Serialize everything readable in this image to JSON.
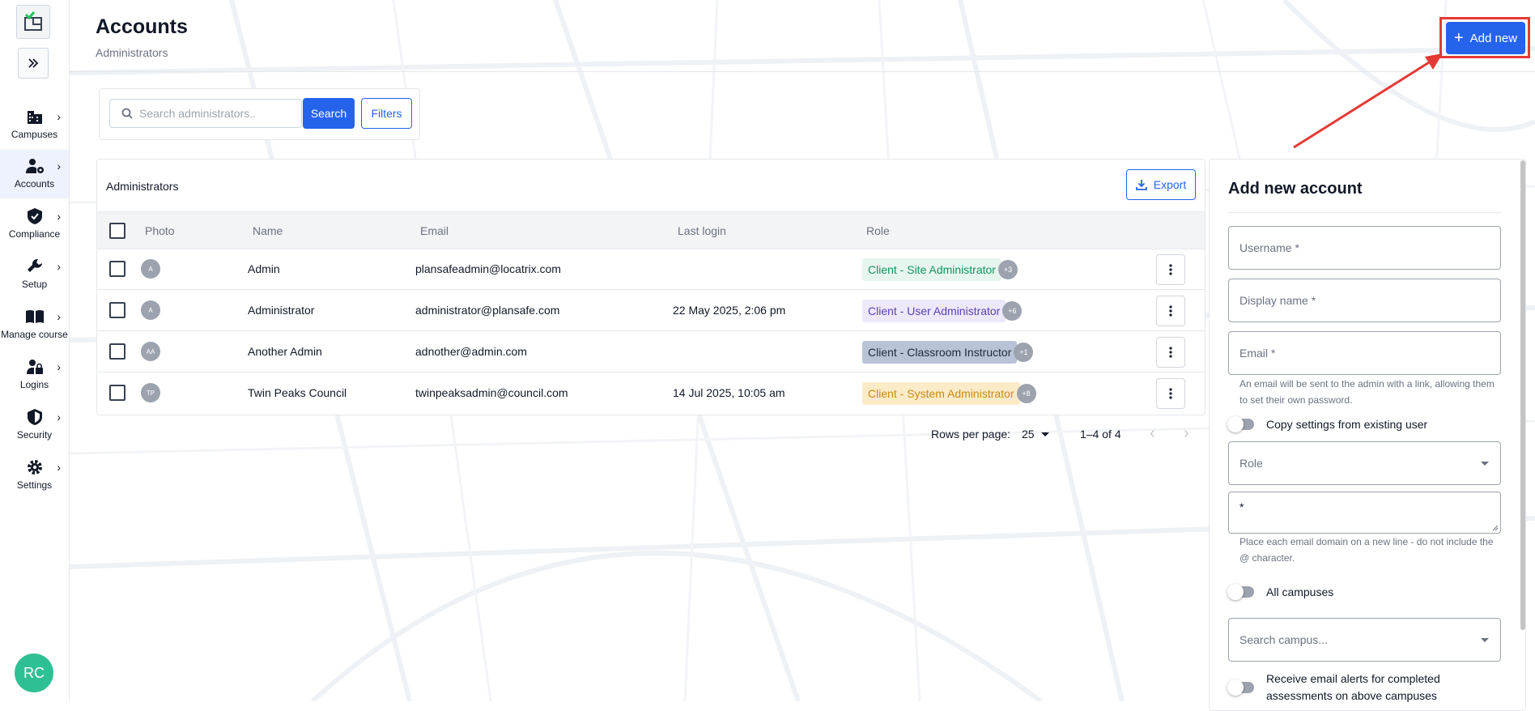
{
  "sidebar": {
    "items": [
      {
        "label": "Campuses",
        "icon": "building-icon"
      },
      {
        "label": "Accounts",
        "icon": "users-cog-icon",
        "active": true
      },
      {
        "label": "Compliance",
        "icon": "shield-check-icon"
      },
      {
        "label": "Setup",
        "icon": "wrench-icon"
      },
      {
        "label": "Manage course",
        "icon": "book-icon"
      },
      {
        "label": "Logins",
        "icon": "user-lock-icon"
      },
      {
        "label": "Security",
        "icon": "shield-half-icon"
      },
      {
        "label": "Settings",
        "icon": "gear-icon"
      }
    ],
    "user_initials": "RC"
  },
  "header": {
    "title": "Accounts",
    "subtitle": "Administrators",
    "add_new_label": "Add new"
  },
  "search": {
    "placeholder": "Search administrators..",
    "search_label": "Search",
    "filters_label": "Filters"
  },
  "table": {
    "title": "Administrators",
    "export_label": "Export",
    "columns": {
      "photo": "Photo",
      "name": "Name",
      "email": "Email",
      "last_login": "Last login",
      "role": "Role"
    },
    "rows": [
      {
        "initials": "A",
        "name": "Admin",
        "email": "plansafeadmin@locatrix.com",
        "last_login": "",
        "role": "Client - Site Administrator",
        "more": "+3"
      },
      {
        "initials": "A",
        "name": "Administrator",
        "email": "administrator@plansafe.com",
        "last_login": "22 May 2025, 2:06 pm",
        "role": "Client - User Administrator",
        "more": "+6"
      },
      {
        "initials": "AA",
        "name": "Another Admin",
        "email": "adnother@admin.com",
        "last_login": "",
        "role": "Client - Classroom Instructor",
        "more": "+1"
      },
      {
        "initials": "TP",
        "name": "Twin Peaks Council",
        "email": "twinpeaksadmin@council.com",
        "last_login": "14 Jul 2025, 10:05 am",
        "role": "Client - System Administrator",
        "more": "+8"
      }
    ]
  },
  "pagination": {
    "rows_per_page_label": "Rows per page:",
    "rows_per_page": "25",
    "range": "1–4 of 4"
  },
  "form": {
    "title": "Add new account",
    "username_placeholder": "Username *",
    "display_name_placeholder": "Display name *",
    "email_placeholder": "Email *",
    "email_help": "An email will be sent to the admin with a link, allowing them to set their own password.",
    "copy_settings_label": "Copy settings from existing user",
    "role_placeholder": "Role",
    "domains_value": "*",
    "domains_help": "Place each email domain on a new line - do not include the @ character.",
    "all_campuses_label": "All campuses",
    "search_campus_placeholder": "Search campus...",
    "email_alerts_label": "Receive email alerts for completed assessments on above campuses"
  },
  "colors": {
    "primary": "#2563eb",
    "highlight": "#e53935",
    "role_site_bg": "#e6f6ef",
    "role_site_fg": "#15925e",
    "role_user_bg": "#ede9fb",
    "role_user_fg": "#5b3fb5",
    "role_instr_bg": "#b8c4d6",
    "role_instr_fg": "#1f2937",
    "role_sys_bg": "#fcebc7",
    "role_sys_fg": "#c98a12"
  }
}
